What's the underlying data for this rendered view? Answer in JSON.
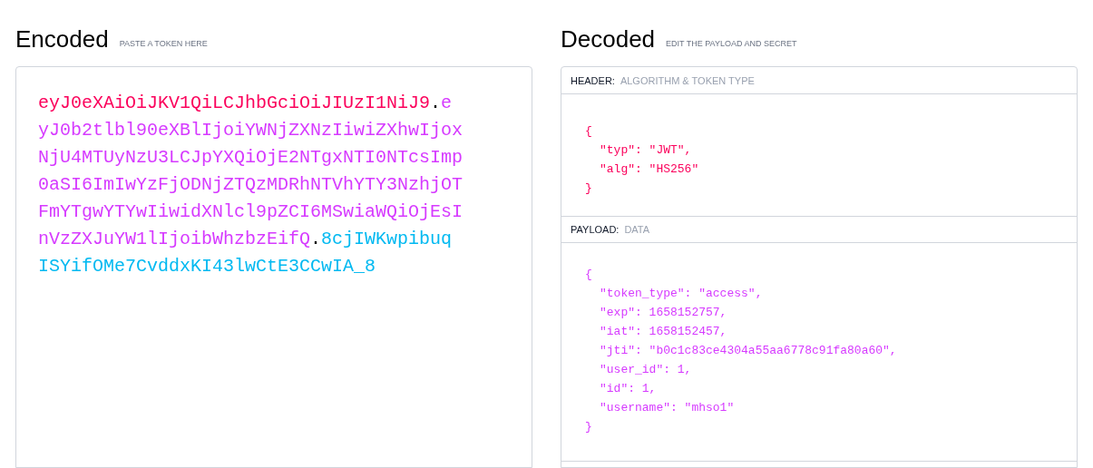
{
  "encoded": {
    "title": "Encoded",
    "hint": "PASTE A TOKEN HERE",
    "segments": [
      {
        "text": "eyJ0eXAiOiJKV1QiLCJhbGciOiJIUzI1NiJ9",
        "color": "#fb015b"
      },
      {
        "text": ".",
        "color": "#000000"
      },
      {
        "text": "eyJ0b2tlbl90eXBlIjoiYWNjZXNzIiwiZXhwIjoxNjU4MTUyNzU3LCJpYXQiOjE2NTgxNTI0NTcsImp0aSI6ImIwYzFjODNjZTQzMDRhNTVhYTY3NzhjOTFmYTgwYTYwIiwidXNlcl9pZCI6MSwiaWQiOjEsInVzZXJuYW1lIjoibWhzbzEifQ",
        "color": "#d63aff"
      },
      {
        "text": ".",
        "color": "#000000"
      },
      {
        "text": "8cjIWKwpibuqISYifOMe7CvddxKI43lwCtE3CCwIA_8",
        "color": "#00b9f1"
      }
    ]
  },
  "decoded": {
    "title": "Decoded",
    "hint": "EDIT THE PAYLOAD AND SECRET",
    "sections": [
      {
        "label": "HEADER:",
        "sublabel": "ALGORITHM & TOKEN TYPE",
        "color": "#fb015b",
        "open": "{",
        "entries": [
          "\"typ\": \"JWT\",",
          "\"alg\": \"HS256\""
        ],
        "close": "}"
      },
      {
        "label": "PAYLOAD:",
        "sublabel": "DATA",
        "color": "#d63aff",
        "open": "{",
        "entries": [
          "\"token_type\": \"access\",",
          "\"exp\": 1658152757,",
          "\"iat\": 1658152457,",
          "\"jti\": \"b0c1c83ce4304a55aa6778c91fa80a60\",",
          "\"user_id\": 1,",
          "\"id\": 1,",
          "\"username\": \"mhso1\""
        ],
        "close": "}"
      }
    ]
  }
}
